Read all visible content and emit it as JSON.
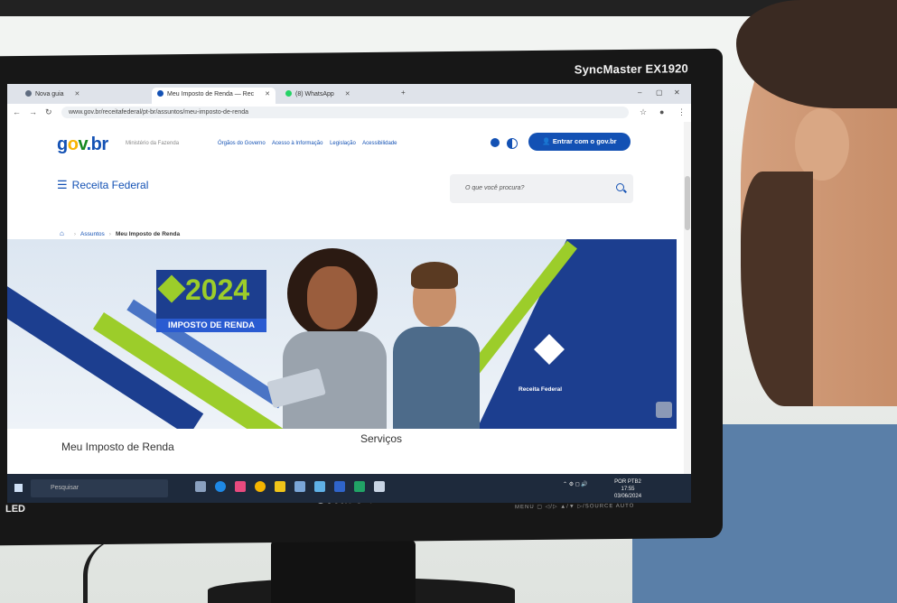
{
  "monitor": {
    "model": "SyncMaster EX1920",
    "brand": "SAMSUNG",
    "led_label": "LED",
    "controls": "MENU ▢ ◁/▷ ▲/▼ ▷/SOURCE AUTO"
  },
  "browser": {
    "tabs": [
      {
        "label": "Nova guia"
      },
      {
        "label": "Meu Imposto de Renda — Rec"
      },
      {
        "label": "(8) WhatsApp"
      }
    ],
    "url": "www.gov.br/receitafederal/pt-br/assuntos/meu-imposto-de-renda"
  },
  "page": {
    "logo_parts": [
      "g",
      "o",
      "v",
      ".br"
    ],
    "ministerio": "Ministério da Fazenda",
    "top_links": [
      "Órgãos do Governo",
      "Acesso à Informação",
      "Legislação",
      "Acessibilidade"
    ],
    "login_button": "Entrar com o gov.br",
    "site_title": "Receita Federal",
    "search_placeholder": "O que você procura?",
    "breadcrumb": {
      "item1": "Assuntos",
      "current": "Meu Imposto de Renda"
    },
    "banner": {
      "year": "2024",
      "subtitle": "IMPOSTO DE RENDA",
      "org": "Receita Federal"
    },
    "section_left": "Meu Imposto de Renda",
    "section_right": "Serviços"
  },
  "taskbar": {
    "search": "Pesquisar",
    "lang": "POR PTB2",
    "time": "17:55",
    "date": "03/06/2024"
  },
  "colors": {
    "gov_blue": "#1351b4",
    "banner_navy": "#1c3e8f",
    "banner_green": "#9ccd2a"
  }
}
